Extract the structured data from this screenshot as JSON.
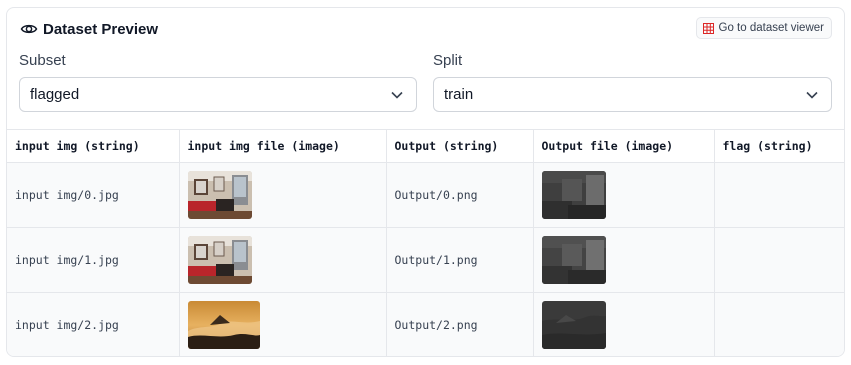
{
  "header": {
    "title": "Dataset Preview",
    "viewer_button": "Go to dataset viewer"
  },
  "subset": {
    "label": "Subset",
    "value": "flagged"
  },
  "split": {
    "label": "Split",
    "value": "train"
  },
  "table": {
    "columns": [
      "input img (string)",
      "input img file (image)",
      "Output (string)",
      "Output file (image)",
      "flag (string)"
    ],
    "rows": [
      {
        "input_img": "input img/0.jpg",
        "output": "Output/0.png",
        "flag": ""
      },
      {
        "input_img": "input img/1.jpg",
        "output": "Output/1.png",
        "flag": ""
      },
      {
        "input_img": "input img/2.jpg",
        "output": "Output/2.png",
        "flag": ""
      }
    ]
  },
  "colors": {
    "accent_icon": "#dc2626",
    "border": "#e5e7eb",
    "row_bg": "#f9fafb"
  }
}
